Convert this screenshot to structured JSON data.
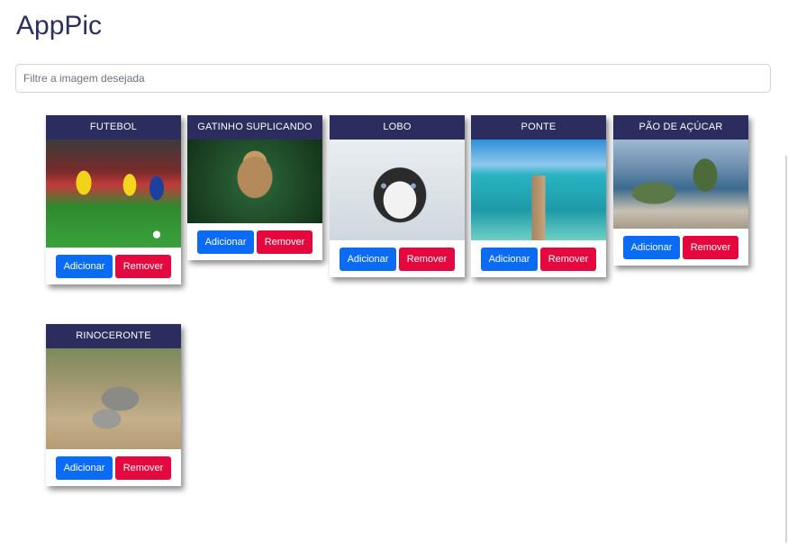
{
  "app": {
    "title": "AppPic"
  },
  "filter": {
    "placeholder": "Filtre a imagem desejada",
    "value": ""
  },
  "cards": [
    {
      "title": "FUTEBOL",
      "add_label": "Adicionar",
      "remove_label": "Remover"
    },
    {
      "title": "GATINHO SUPLICANDO",
      "add_label": "Adicionar",
      "remove_label": "Remover"
    },
    {
      "title": "LOBO",
      "add_label": "Adicionar",
      "remove_label": "Remover"
    },
    {
      "title": "PONTE",
      "add_label": "Adicionar",
      "remove_label": "Remover"
    },
    {
      "title": "PÃO DE AÇÚCAR",
      "add_label": "Adicionar",
      "remove_label": "Remover"
    },
    {
      "title": "RINOCERONTE",
      "add_label": "Adicionar",
      "remove_label": "Remover"
    }
  ],
  "colors": {
    "title_text": "#2c3060",
    "card_header": "#2b2d5e",
    "add_button": "#0a6cf5",
    "remove_button": "#e5083e"
  }
}
